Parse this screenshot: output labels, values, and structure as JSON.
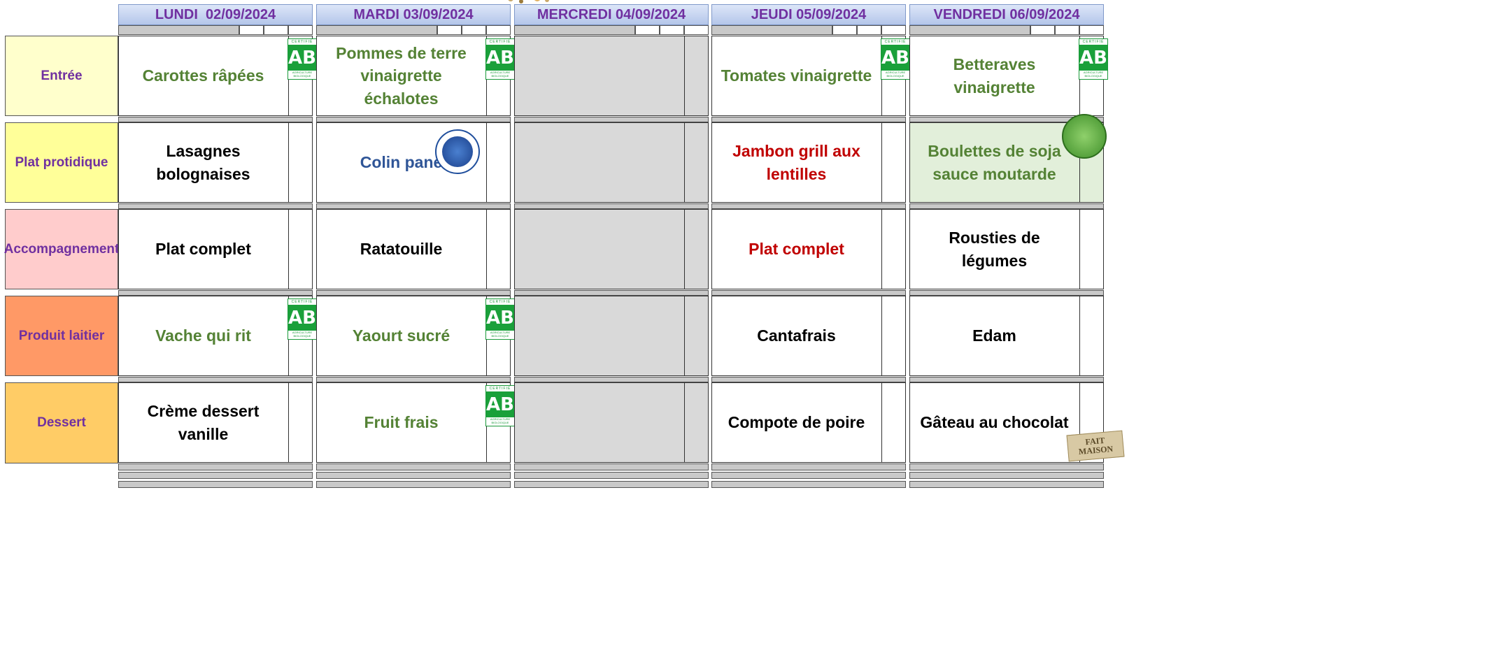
{
  "days": [
    {
      "label": "LUNDI  02/09/2024"
    },
    {
      "label": "MARDI 03/09/2024"
    },
    {
      "label": "MERCREDI 04/09/2024"
    },
    {
      "label": "JEUDI 05/09/2024"
    },
    {
      "label": "VENDREDI 06/09/2024"
    }
  ],
  "categories": [
    {
      "label": "Entrée",
      "color": "#ffffcc"
    },
    {
      "label": "Plat protidique",
      "color": "#ffff99"
    },
    {
      "label": "Accompagnement",
      "color": "#ffcccc"
    },
    {
      "label": "Produit laitier",
      "color": "#ff9966"
    },
    {
      "label": "Dessert",
      "color": "#ffcc66"
    }
  ],
  "menu": [
    [
      {
        "text": "Carottes râpées",
        "color": "green",
        "bio": true
      },
      {
        "text": "Lasagnes bolognaises",
        "color": "black"
      },
      {
        "text": "Plat complet",
        "color": "black"
      },
      {
        "text": "Vache qui rit",
        "color": "green",
        "bio": true
      },
      {
        "text": "Crème dessert vanille",
        "color": "black"
      }
    ],
    [
      {
        "text": "Pommes de terre vinaigrette échalotes",
        "color": "green",
        "bio": true
      },
      {
        "text": "Colin pané",
        "color": "blue",
        "badge": "peche-durable"
      },
      {
        "text": "Ratatouille",
        "color": "black"
      },
      {
        "text": "Yaourt sucré",
        "color": "green",
        "bio": true
      },
      {
        "text": "Fruit frais",
        "color": "green",
        "bio": true
      }
    ],
    [
      {
        "text": "",
        "closed": true
      },
      {
        "text": "",
        "closed": true
      },
      {
        "text": "",
        "closed": true
      },
      {
        "text": "",
        "closed": true
      },
      {
        "text": "",
        "closed": true
      }
    ],
    [
      {
        "text": "Tomates vinaigrette",
        "color": "green",
        "bio": true
      },
      {
        "text": "Jambon grill aux lentilles",
        "color": "red"
      },
      {
        "text": "Plat complet",
        "color": "red"
      },
      {
        "text": "Cantafrais",
        "color": "black"
      },
      {
        "text": "Compote de poire",
        "color": "black"
      }
    ],
    [
      {
        "text": "Betteraves vinaigrette",
        "color": "green",
        "bio": true
      },
      {
        "text": "Boulettes de soja sauce moutarde",
        "color": "green",
        "vege": true,
        "badge": "leaf"
      },
      {
        "text": "Rousties de légumes",
        "color": "black"
      },
      {
        "text": "Edam",
        "color": "black"
      },
      {
        "text": "Gâteau au chocolat",
        "color": "black",
        "badge": "fait-maison"
      }
    ]
  ],
  "badges": {
    "bio_logo": "AB",
    "bio_top": "CERTIFIÉ",
    "bio_bottom": "AGRICULTURE BIOLOGIQUE",
    "fait_maison": "FAIT MAISON",
    "peche_durable": "Pêche Durable"
  },
  "colors": {
    "header_text": "#7030a0",
    "green_dish": "#548235",
    "red_dish": "#c00000",
    "blue_dish": "#2f5597",
    "closed_day": "#d9d9d9",
    "vege_cell": "#e2efda"
  }
}
